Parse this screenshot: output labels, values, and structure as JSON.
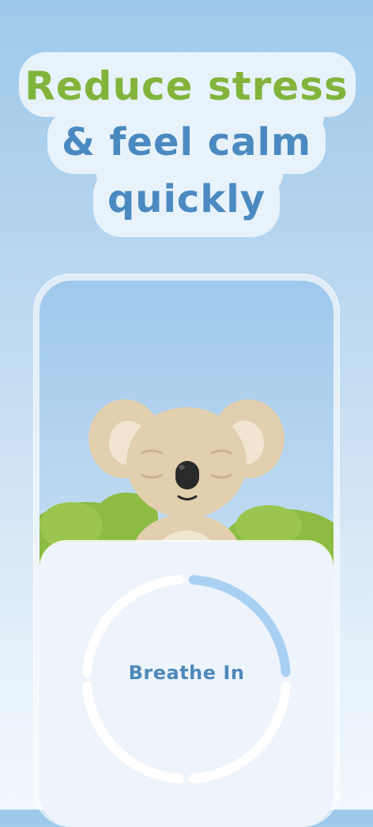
{
  "headline": {
    "line1": "Reduce stress",
    "line2": "& feel calm",
    "line3": "quickly"
  },
  "breathing": {
    "label": "Breathe In",
    "progress": 0.25
  },
  "illustration": {
    "character": "koala",
    "state": "eyes closed, sleeping/relaxed"
  },
  "colors": {
    "headline_green": "#82b43c",
    "headline_blue": "#4a8ac0",
    "ring_progress": "#a9d0f2",
    "ring_track": "#ffffff",
    "label": "#4e88bb"
  }
}
